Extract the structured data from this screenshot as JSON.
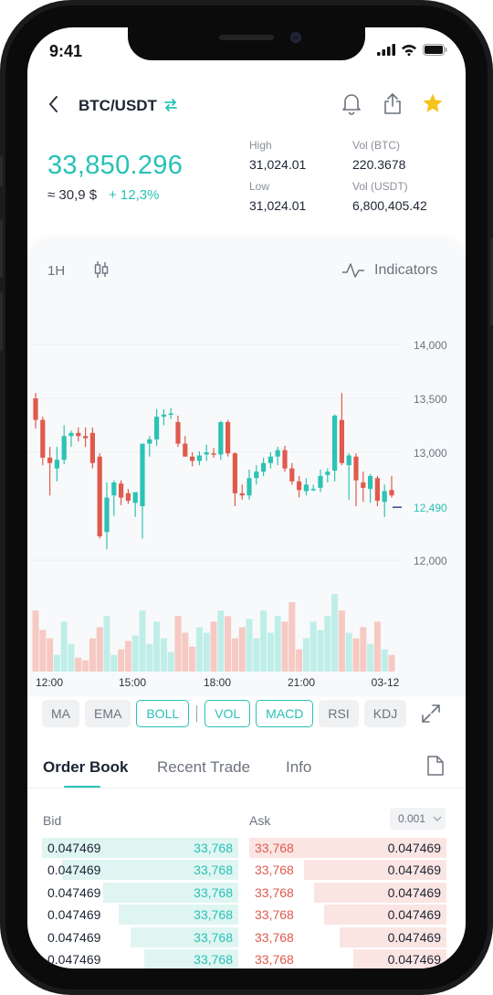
{
  "status_bar": {
    "time": "9:41"
  },
  "header": {
    "pair": "BTC/USDT"
  },
  "price": {
    "last": "33,850.296",
    "fiat": "≈ 30,9 $",
    "change": "+ 12,3%",
    "high_label": "High",
    "high_value": "31,024.01",
    "low_label": "Low",
    "low_value": "31,024.01",
    "vol_btc_label": "Vol (BTC)",
    "vol_btc_value": "220.3678",
    "vol_usdt_label": "Vol (USDT)",
    "vol_usdt_value": "6,800,405.42"
  },
  "chart_controls": {
    "interval": "1H",
    "indicators_label": "Indicators"
  },
  "chart_data": {
    "type": "candlestick",
    "y_ticks": [
      "14,000",
      "13,500",
      "13,000",
      "12,490",
      "12,000"
    ],
    "current_price_label": "12,490",
    "x_ticks": [
      "12:00",
      "15:00",
      "18:00",
      "21:00",
      "03-12"
    ],
    "colors": {
      "up": "#2cc3b5",
      "down": "#e05a4e",
      "up_volume": "#bfeee8",
      "down_volume": "#f6c9c3"
    },
    "candles": [
      {
        "o": 13500,
        "h": 13550,
        "l": 13220,
        "c": 13300
      },
      {
        "o": 13300,
        "h": 13330,
        "l": 12880,
        "c": 12950
      },
      {
        "o": 12950,
        "h": 13050,
        "l": 12600,
        "c": 12900
      },
      {
        "o": 12850,
        "h": 13050,
        "l": 12730,
        "c": 12930
      },
      {
        "o": 12930,
        "h": 13250,
        "l": 12890,
        "c": 13150
      },
      {
        "o": 13150,
        "h": 13200,
        "l": 13050,
        "c": 13180
      },
      {
        "o": 13180,
        "h": 13230,
        "l": 13100,
        "c": 13150
      },
      {
        "o": 13150,
        "h": 13230,
        "l": 13050,
        "c": 13130
      },
      {
        "o": 13180,
        "h": 13230,
        "l": 12850,
        "c": 12900
      },
      {
        "o": 12960,
        "h": 12990,
        "l": 12200,
        "c": 12220
      },
      {
        "o": 12260,
        "h": 12720,
        "l": 12100,
        "c": 12580
      },
      {
        "o": 12600,
        "h": 12740,
        "l": 12410,
        "c": 12720
      },
      {
        "o": 12710,
        "h": 12740,
        "l": 12510,
        "c": 12580
      },
      {
        "o": 12620,
        "h": 12660,
        "l": 12520,
        "c": 12550
      },
      {
        "o": 12530,
        "h": 12620,
        "l": 12400,
        "c": 12630
      },
      {
        "o": 12500,
        "h": 12720,
        "l": 12200,
        "c": 13080
      },
      {
        "o": 13080,
        "h": 13150,
        "l": 12960,
        "c": 13120
      },
      {
        "o": 13120,
        "h": 13400,
        "l": 13060,
        "c": 13330
      },
      {
        "o": 13330,
        "h": 13400,
        "l": 13250,
        "c": 13350
      },
      {
        "o": 13350,
        "h": 13410,
        "l": 13310,
        "c": 13360
      },
      {
        "o": 13280,
        "h": 13340,
        "l": 13050,
        "c": 13080
      },
      {
        "o": 13080,
        "h": 13150,
        "l": 12960,
        "c": 12960
      },
      {
        "o": 12960,
        "h": 13000,
        "l": 12870,
        "c": 12920
      },
      {
        "o": 12920,
        "h": 13010,
        "l": 12880,
        "c": 12970
      },
      {
        "o": 12980,
        "h": 13070,
        "l": 12920,
        "c": 13000
      },
      {
        "o": 12990,
        "h": 13040,
        "l": 12950,
        "c": 12980
      },
      {
        "o": 12980,
        "h": 13290,
        "l": 12930,
        "c": 13280
      },
      {
        "o": 13280,
        "h": 13300,
        "l": 12960,
        "c": 12990
      },
      {
        "o": 12990,
        "h": 13000,
        "l": 12500,
        "c": 12620
      },
      {
        "o": 12620,
        "h": 12700,
        "l": 12560,
        "c": 12600
      },
      {
        "o": 12600,
        "h": 12840,
        "l": 12560,
        "c": 12760
      },
      {
        "o": 12760,
        "h": 12880,
        "l": 12700,
        "c": 12820
      },
      {
        "o": 12820,
        "h": 12950,
        "l": 12780,
        "c": 12900
      },
      {
        "o": 12900,
        "h": 13000,
        "l": 12850,
        "c": 12960
      },
      {
        "o": 12960,
        "h": 13050,
        "l": 12880,
        "c": 13020
      },
      {
        "o": 13020,
        "h": 13060,
        "l": 12820,
        "c": 12850
      },
      {
        "o": 12850,
        "h": 12900,
        "l": 12700,
        "c": 12730
      },
      {
        "o": 12730,
        "h": 12780,
        "l": 12580,
        "c": 12650
      },
      {
        "o": 12640,
        "h": 12760,
        "l": 12600,
        "c": 12700
      },
      {
        "o": 12650,
        "h": 12700,
        "l": 12640,
        "c": 12660
      },
      {
        "o": 12670,
        "h": 12840,
        "l": 12630,
        "c": 12780
      },
      {
        "o": 12790,
        "h": 12850,
        "l": 12720,
        "c": 12820
      },
      {
        "o": 12830,
        "h": 13350,
        "l": 12730,
        "c": 13340
      },
      {
        "o": 13300,
        "h": 13550,
        "l": 12880,
        "c": 12900
      },
      {
        "o": 12880,
        "h": 12990,
        "l": 12560,
        "c": 12970
      },
      {
        "o": 12960,
        "h": 12990,
        "l": 12500,
        "c": 12740
      },
      {
        "o": 12720,
        "h": 12820,
        "l": 12540,
        "c": 12670
      },
      {
        "o": 12660,
        "h": 12800,
        "l": 12530,
        "c": 12780
      },
      {
        "o": 12760,
        "h": 12780,
        "l": 12500,
        "c": 12550
      },
      {
        "o": 12540,
        "h": 12700,
        "l": 12400,
        "c": 12640
      },
      {
        "o": 12650,
        "h": 12780,
        "l": 12580,
        "c": 12600
      }
    ],
    "volumes": [
      22,
      15,
      12,
      6,
      18,
      10,
      5,
      4,
      12,
      16,
      20,
      6,
      8,
      11,
      13,
      22,
      10,
      18,
      12,
      7,
      20,
      14,
      9,
      16,
      14,
      18,
      22,
      20,
      12,
      16,
      19,
      12,
      22,
      14,
      20,
      18,
      25,
      8,
      12,
      18,
      15,
      20,
      28,
      22,
      14,
      12,
      16,
      10,
      18,
      8,
      6
    ]
  },
  "indicators": [
    "MA",
    "EMA",
    "BOLL",
    "VOL",
    "MACD",
    "RSI",
    "KDJ"
  ],
  "order_book": {
    "tabs": [
      "Order Book",
      "Recent Trade",
      "Info"
    ],
    "bid_label": "Bid",
    "ask_label": "Ask",
    "precision": "0.001",
    "rows": [
      {
        "bid_price": "0.047469",
        "bid_amount": "33,768",
        "ask_amount": "33,768",
        "ask_price": "0.047469",
        "bid_depth": 1.0,
        "ask_depth": 1.0
      },
      {
        "bid_price": "0.047469",
        "bid_amount": "33,768",
        "ask_amount": "33,768",
        "ask_price": "0.047469",
        "bid_depth": 0.9,
        "ask_depth": 0.72
      },
      {
        "bid_price": "0.047469",
        "bid_amount": "33,768",
        "ask_amount": "33,768",
        "ask_price": "0.047469",
        "bid_depth": 0.69,
        "ask_depth": 0.67
      },
      {
        "bid_price": "0.047469",
        "bid_amount": "33,768",
        "ask_amount": "33,768",
        "ask_price": "0.047469",
        "bid_depth": 0.61,
        "ask_depth": 0.62
      },
      {
        "bid_price": "0.047469",
        "bid_amount": "33,768",
        "ask_amount": "33,768",
        "ask_price": "0.047469",
        "bid_depth": 0.55,
        "ask_depth": 0.54
      },
      {
        "bid_price": "0.047469",
        "bid_amount": "33,768",
        "ask_amount": "33,768",
        "ask_price": "0.047469",
        "bid_depth": 0.48,
        "ask_depth": 0.47
      }
    ]
  }
}
